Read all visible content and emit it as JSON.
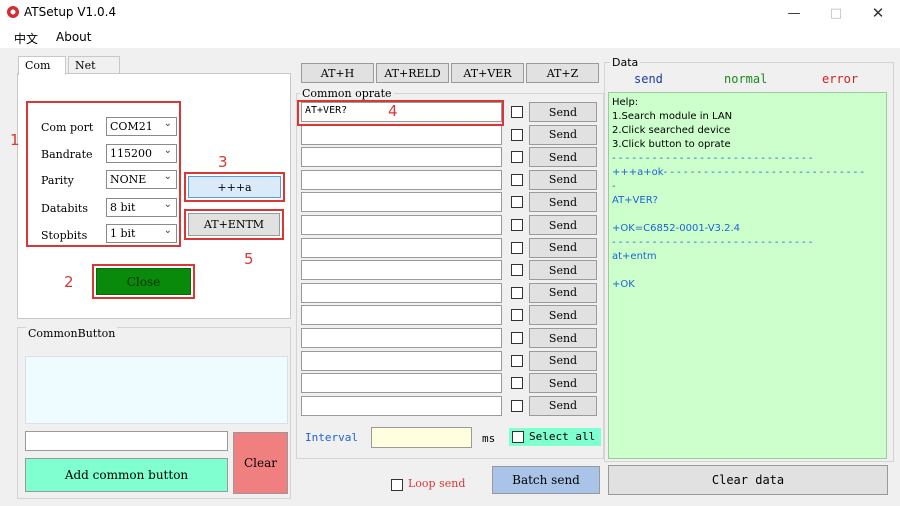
{
  "window": {
    "title": "ATSetup V1.0.4"
  },
  "menu": [
    "中文",
    "About"
  ],
  "tabs": [
    "Com",
    "Net"
  ],
  "com_settings": [
    {
      "label": "Com port",
      "value": "COM21"
    },
    {
      "label": "Bandrate",
      "value": "115200"
    },
    {
      "label": "Parity",
      "value": "NONE"
    },
    {
      "label": "Databits",
      "value": "8 bit"
    },
    {
      "label": "Stopbits",
      "value": "1 bit"
    }
  ],
  "buttons": {
    "plus": "+++a",
    "entm": "AT+ENTM",
    "close": "Close",
    "add_common": "Add common button",
    "clear": "Clear",
    "loop_send": "Loop send",
    "batch_send": "Batch send",
    "clear_data": "Clear data",
    "select_all": "Select all"
  },
  "common_button": {
    "title": "CommonButton",
    "input_value": ""
  },
  "at_buttons": [
    "AT+H",
    "AT+RELD",
    "AT+VER",
    "AT+Z"
  ],
  "common_oprate": {
    "title": "Common oprate",
    "rows": [
      "AT+VER?",
      "",
      "",
      "",
      "",
      "",
      "",
      "",
      "",
      "",
      "",
      "",
      "",
      ""
    ],
    "send_label": "Send"
  },
  "interval": {
    "label": "Interval",
    "value": "",
    "unit": "ms"
  },
  "data_panel": {
    "title": "Data",
    "legend": [
      "send",
      "normal",
      "error"
    ],
    "lines": [
      {
        "text": "Help:",
        "style": "black"
      },
      {
        "text": "1.Search module in LAN",
        "style": "black"
      },
      {
        "text": "2.Click searched device",
        "style": "black"
      },
      {
        "text": "3.Click button to oprate",
        "style": "black"
      },
      {
        "text": "- - - - - - - - - - - - - - - - - - - - - - - - - - - - - -",
        "style": "sep"
      },
      {
        "text": "+++a+ok- - - - - - - - - - - - - - - - - - - - - - - - - - - - - -",
        "style": "sep"
      },
      {
        "text": "-",
        "style": "blue"
      },
      {
        "text": "AT+VER?",
        "style": "blue"
      },
      {
        "text": "",
        "style": "blue"
      },
      {
        "text": "+OK=C6852-0001-V3.2.4",
        "style": "blue"
      },
      {
        "text": "- - - - - - - - - - - - - - - - - - - - - - - - - - - - - -",
        "style": "sep"
      },
      {
        "text": "at+entm",
        "style": "blue"
      },
      {
        "text": "",
        "style": "blue"
      },
      {
        "text": "+OK",
        "style": "blue"
      }
    ]
  },
  "annotations": [
    "1",
    "2",
    "3",
    "4",
    "5"
  ],
  "colors": {
    "close_button": "#0a8a0a",
    "add_common": "#80ffd0",
    "clear_button": "#f08080",
    "batch_send": "#a9c4e8",
    "data_bg": "#ccffcc",
    "legend_send": "#1a3caa",
    "legend_normal": "#1a8a1a",
    "legend_error": "#d02020",
    "annotation": "#d93636"
  }
}
